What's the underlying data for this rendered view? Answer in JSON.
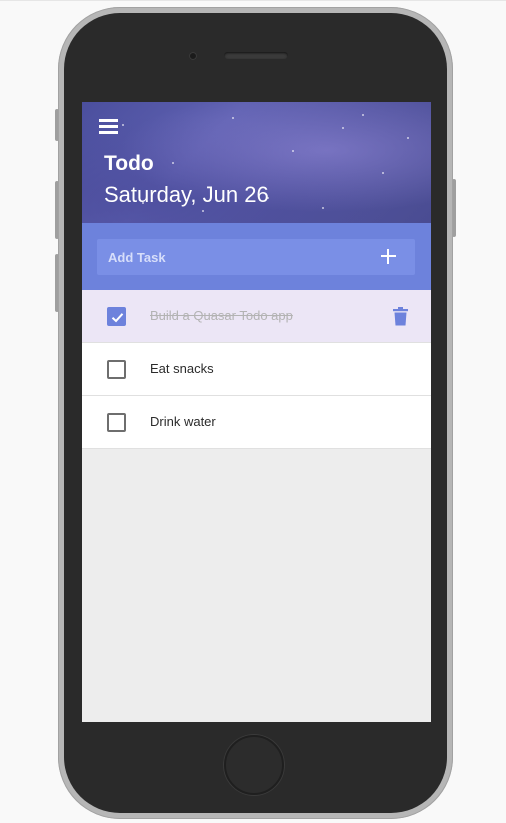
{
  "app": {
    "title": "Todo",
    "date": "Saturday, Jun 26"
  },
  "add_task": {
    "placeholder": "Add Task"
  },
  "tasks": [
    {
      "label": "Build a Quasar Todo app",
      "done": true
    },
    {
      "label": "Eat snacks",
      "done": false
    },
    {
      "label": "Drink water",
      "done": false
    }
  ],
  "icons": {
    "menu": "menu-icon",
    "add": "plus-icon",
    "check": "checkmark-icon",
    "delete": "trash-icon"
  },
  "colors": {
    "accent": "#6d82dc",
    "done_row": "#ece6f6",
    "header": "#5558a6"
  }
}
